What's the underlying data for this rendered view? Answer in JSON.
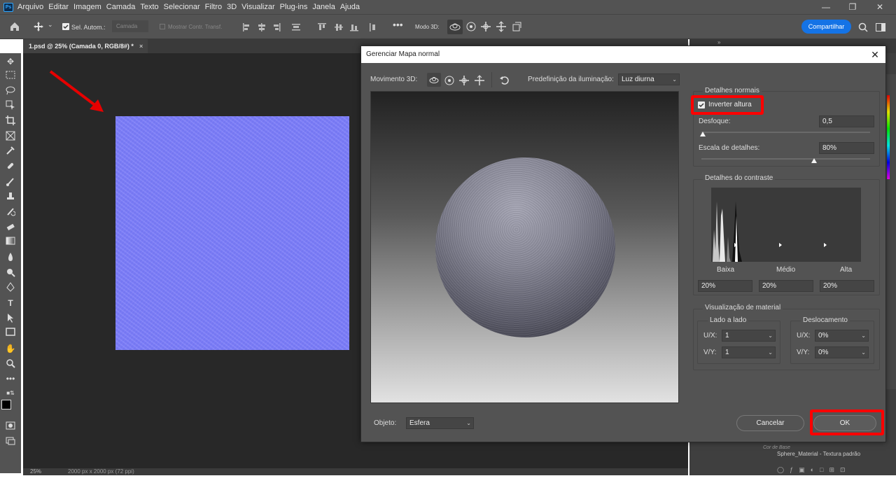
{
  "menubar": {
    "items": [
      "Arquivo",
      "Editar",
      "Imagem",
      "Camada",
      "Texto",
      "Selecionar",
      "Filtro",
      "3D",
      "Visualizar",
      "Plug-ins",
      "Janela",
      "Ajuda"
    ]
  },
  "options": {
    "auto_select_label": "Sel. Autom.:",
    "auto_select_value": "Camada",
    "transform_label": "Mostrar Contr. Transf.",
    "mode3d_label": "Modo 3D:",
    "share_label": "Compartilhar"
  },
  "document": {
    "tab_title": "1.psd @ 25% (Camada 0, RGB/8#) *",
    "zoom": "25%",
    "size_info": "2000 px x 2000 px (72 ppi)"
  },
  "panel": {
    "layer_sub": "Cor de Base",
    "layer_text": "Sphere_Material - Textura padrão"
  },
  "dialog": {
    "title": "Gerenciar Mapa normal",
    "move3d_label": "Movimento 3D:",
    "lighting_label": "Predefinição da iluminação:",
    "lighting_value": "Luz diurna",
    "object_label": "Objeto:",
    "object_value": "Esfera",
    "normal_details": {
      "title": "Detalhes normais",
      "invert_label": "Inverter altura",
      "invert_checked": true,
      "blur_label": "Desfoque:",
      "blur_value": "0,5",
      "detail_scale_label": "Escala de detalhes:",
      "detail_scale_value": "80%"
    },
    "contrast": {
      "title": "Detalhes do contraste",
      "low_label": "Baixa",
      "mid_label": "Médio",
      "high_label": "Alta",
      "low_value": "20%",
      "mid_value": "20%",
      "high_value": "20%"
    },
    "material": {
      "title": "Visualização de material",
      "tile_title": "Lado a lado",
      "offset_title": "Deslocamento",
      "ux_label": "U/X:",
      "vy_label": "V/Y:",
      "tile_ux": "1",
      "tile_vy": "1",
      "offset_ux": "0%",
      "offset_vy": "0%"
    },
    "cancel_label": "Cancelar",
    "ok_label": "OK"
  },
  "colors": {
    "accent": "#1473e6",
    "highlight_box": "#ff0000",
    "normal_map": "#7b7ff6"
  }
}
